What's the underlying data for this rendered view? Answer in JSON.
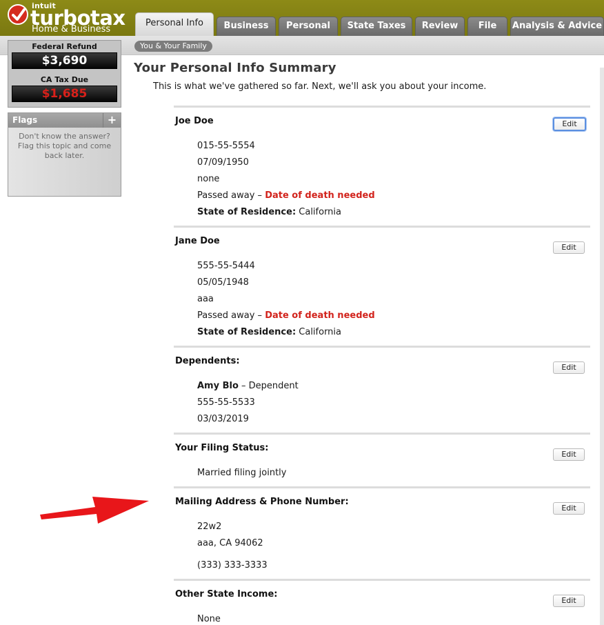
{
  "brand": {
    "intuit": "intuit",
    "product": "turbotax",
    "edition": "Home & Business"
  },
  "tabs": [
    {
      "label": "Personal Info",
      "active": true
    },
    {
      "label": "Business",
      "active": false
    },
    {
      "label": "Personal",
      "active": false
    },
    {
      "label": "State Taxes",
      "active": false
    },
    {
      "label": "Review",
      "active": false
    },
    {
      "label": "File",
      "active": false
    },
    {
      "label": "Analysis & Advice",
      "active": false
    }
  ],
  "subtab": {
    "label": "You & Your Family"
  },
  "sidebar": {
    "federal_label": "Federal Refund",
    "federal_value": "$3,690",
    "state_label": "CA Tax Due",
    "state_value": "$1,685",
    "flags_title": "Flags",
    "flags_add": "+",
    "flags_text": "Don't know the answer? Flag this topic and come back later."
  },
  "main": {
    "title": "Your Personal Info Summary",
    "subtitle": "This is what we've gathered so far. Next, we'll ask you about your income."
  },
  "edit_label": "Edit",
  "sections": {
    "taxpayer": {
      "name": "Joe  Doe",
      "ssn": "015-55-5554",
      "dob": "07/09/1950",
      "occupation": "none",
      "status_prefix": "Passed away – ",
      "status_alert": "Date of death needed",
      "residence_label": "State of Residence:",
      "residence_value": " California"
    },
    "spouse": {
      "name": "Jane  Doe",
      "ssn": "555-55-5444",
      "dob": "05/05/1948",
      "occupation": "aaa",
      "status_prefix": "Passed away – ",
      "status_alert": "Date of death needed",
      "residence_label": "State of Residence:",
      "residence_value": " California"
    },
    "dependents": {
      "heading": "Dependents:",
      "name": "Amy  Blo",
      "relation": "  – Dependent",
      "ssn": "555-55-5533",
      "dob": "03/03/2019"
    },
    "filing": {
      "heading": "Your Filing Status:",
      "value": "Married filing jointly"
    },
    "mailing": {
      "heading": "Mailing Address & Phone Number:",
      "street": "22w2",
      "city": "aaa, CA 94062",
      "phone": "(333) 333-3333"
    },
    "other_state": {
      "heading": "Other State Income:",
      "value": "None"
    }
  },
  "colors": {
    "topbar": "#8d8a17",
    "alert_red": "#d2231c",
    "annotation_arrow": "#e8161a"
  }
}
